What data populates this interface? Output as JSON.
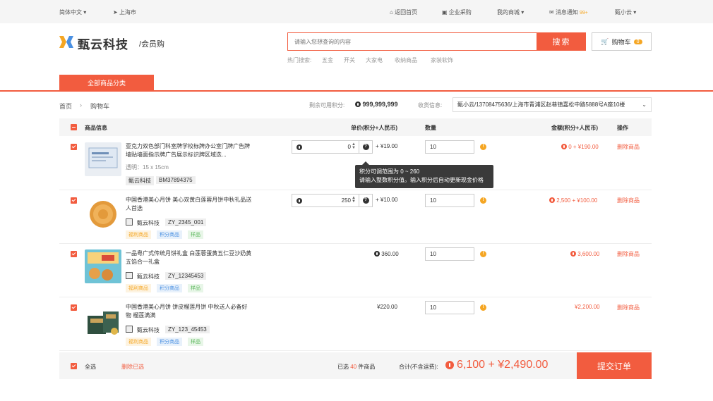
{
  "topbar": {
    "lang": "简体中文",
    "location": "上海市",
    "home": "返回首页",
    "enterprise": "企业采购",
    "mall": "我的商城",
    "messages": "消息通知",
    "messages_badge": "99+",
    "user": "甄小云"
  },
  "header": {
    "logo_text": "甄云科技",
    "logo_sub": "/会员购",
    "search_placeholder": "请输入您想查询的内容",
    "search_button": "搜索",
    "cart_label": "购物车",
    "cart_count": "0",
    "hot_label": "热门搜索:",
    "hot_items": [
      "五金",
      "开关",
      "大家电",
      "收纳商品",
      "家装软饰"
    ]
  },
  "nav": {
    "all_categories": "全部商品分类"
  },
  "breadcrumb": {
    "home": "首页",
    "sep": "›",
    "current": "购物车"
  },
  "points": {
    "label": "剩余可用积分:",
    "value": "999,999,999"
  },
  "address": {
    "label": "收货信息:",
    "value": "甄小云/13708475636/上海市青浦区赵巷镇嘉松中路5888号A座10楼"
  },
  "table": {
    "headers": {
      "product": "商品信息",
      "unit_price": "单价(积分+人民币)",
      "qty": "数量",
      "amount": "金额(积分+人民币)",
      "action": "操作"
    }
  },
  "items": [
    {
      "name": "亚克力双色部门科室牌学校标牌办公室门牌广告牌墙贴墙面指示牌广告展示标识牌区域迭...",
      "attr": "透明：15 x 15cm",
      "brand": "甄云科技",
      "sku": "BM37894375",
      "tags": [],
      "points": "0",
      "rmb": "+ ¥19.00",
      "qty": "10",
      "amount": "0 + ¥190.00",
      "delete": "删除商品"
    },
    {
      "name": "中国香港美心月饼 美心双黄白莲蓉月饼中秋礼品送人首选",
      "attr": "",
      "brand": "甄云科技",
      "sku": "ZY_2345_001",
      "tags": [
        "福利商品",
        "积分商品",
        "样品"
      ],
      "points": "250",
      "rmb": "+ ¥10.00",
      "qty": "10",
      "amount": "2,500 + ¥100.00",
      "delete": "删除商品"
    },
    {
      "name": "一品粤广式传统月饼礼盒 白莲蓉蛋黄五仁豆沙奶黄五馅合一礼盒",
      "attr": "",
      "brand": "甄云科技",
      "sku": "ZY_12345453",
      "tags": [
        "福利商品",
        "积分商品",
        "样品"
      ],
      "unit_only": "360.00",
      "qty": "10",
      "amount": "3,600.00",
      "delete": "删除商品"
    },
    {
      "name": "中国香港美心月饼 饼皮榴莲月饼 中秋送人必备好物 榴莲满满",
      "attr": "",
      "brand": "甄云科技",
      "sku": "ZY_123_45453",
      "tags": [
        "福利商品",
        "积分商品",
        "样品"
      ],
      "unit_only": "¥220.00",
      "qty": "10",
      "amount": "¥2,200.00",
      "delete": "删除商品"
    }
  ],
  "tooltip": {
    "line1": "积分可调范围为 0 ~ 260",
    "line2": "请输入整数积分值。输入积分后自动更新现金价格"
  },
  "footer": {
    "select_all": "全选",
    "delete_selected": "删除已选",
    "selected_prefix": "已选",
    "selected_count": "40",
    "selected_suffix": "件商品",
    "total_label": "合计(不含运费):",
    "total_value": "6,100 + ¥2,490.00",
    "submit": "提交订单"
  },
  "colors": {
    "accent": "#f25c3f",
    "warn": "#f5a623"
  }
}
